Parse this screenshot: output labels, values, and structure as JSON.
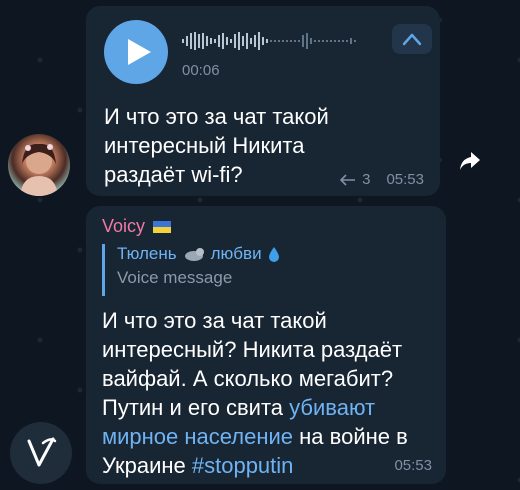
{
  "message1": {
    "voice_duration": "00:06",
    "text": "И что это за чат такой\nинтересный Никита\nраздаёт wi-fi?",
    "reply_count": "3",
    "time": "05:53"
  },
  "message2": {
    "sender": "Voicy",
    "reply": {
      "name": "Тюлень",
      "name_suffix": "любви",
      "subtitle": "Voice message"
    },
    "text_part1": "И что это за чат такой\nинтересный? Никита раздаёт\nвайфай. А сколько мегабит?\nПутин и его свита ",
    "link1": "убивают\nмирное население",
    "text_part2": " на войне в\nУкраине ",
    "hashtag": "#stopputin",
    "time": "05:53"
  },
  "colors": {
    "background": "#0e1621",
    "bubble": "#182533",
    "accent": "#5ea6e6",
    "link": "#6fb3f2",
    "sender": "#f07aa6",
    "meta": "#7f91a4"
  },
  "icons": [
    "play-icon",
    "chevron-up-icon",
    "reply-arrow-icon",
    "forward-icon",
    "ukraine-flag-icon",
    "seal-icon",
    "droplet-icon"
  ]
}
